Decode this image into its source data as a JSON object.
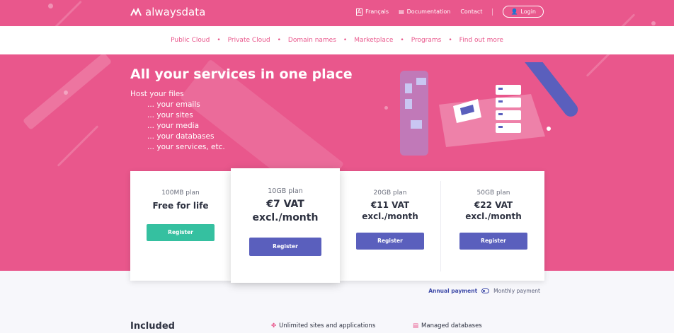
{
  "brand": {
    "name": "alwaysdata",
    "pink": "#e9578c",
    "blue": "#5a5fbd",
    "green": "#35c0a0"
  },
  "topbar": {
    "language": {
      "icon": "translate-icon",
      "label": "Français"
    },
    "documentation": {
      "icon": "book-icon",
      "label": "Documentation"
    },
    "contact": {
      "label": "Contact"
    },
    "login": {
      "icon": "user-icon",
      "label": "Login"
    }
  },
  "nav": {
    "items": [
      "Public Cloud",
      "Private Cloud",
      "Domain names",
      "Marketplace",
      "Programs",
      "Find out more"
    ],
    "separator": "•"
  },
  "hero": {
    "title": "All your services in one place",
    "lines": [
      "Host your files",
      "... your emails",
      "... your sites",
      "... your media",
      "... your databases",
      "... your services, etc."
    ]
  },
  "plans": [
    {
      "name": "100MB plan",
      "price": "Free for life",
      "button": "Register",
      "button_color": "#35c0a0"
    },
    {
      "name": "10GB plan",
      "price_line1": "€7 VAT",
      "price_line2": "excl./month",
      "button": "Register",
      "button_color": "#5a5fbd"
    },
    {
      "name": "20GB plan",
      "price_line1": "€11 VAT",
      "price_line2": "excl./month",
      "button": "Register",
      "button_color": "#5a5fbd"
    },
    {
      "name": "50GB plan",
      "price_line1": "€22 VAT",
      "price_line2": "excl./month",
      "button": "Register",
      "button_color": "#5a5fbd"
    }
  ],
  "billing": {
    "annual": "Annual payment",
    "monthly": "Monthly payment",
    "selected": "Annual payment"
  },
  "included": {
    "title": "Included",
    "features": [
      {
        "icon": "sites-icon",
        "label": "Unlimited sites and applications"
      },
      {
        "icon": "database-icon",
        "label": "Managed databases"
      }
    ]
  }
}
